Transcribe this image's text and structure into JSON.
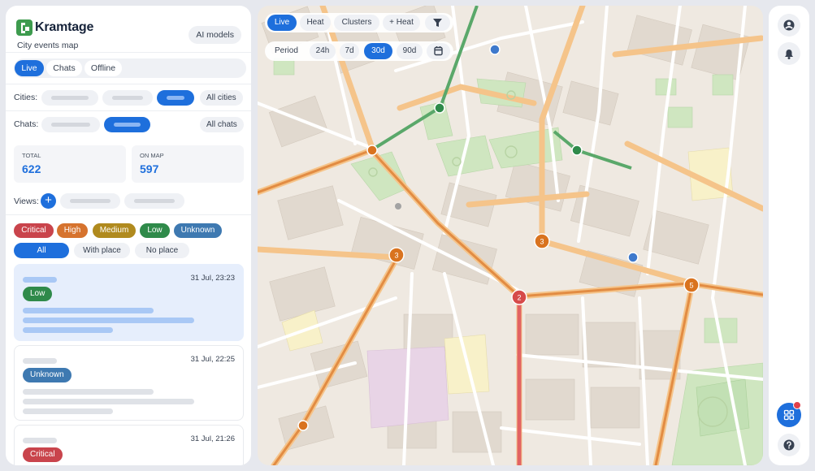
{
  "brand": {
    "name": "Kramtage",
    "subtitle": "City events map"
  },
  "header": {
    "ai_models_label": "AI models"
  },
  "modes": [
    {
      "label": "Live",
      "active": true
    },
    {
      "label": "Chats",
      "active": false
    },
    {
      "label": "Offline",
      "active": false
    }
  ],
  "filters": {
    "cities_label": "Cities:",
    "all_cities_label": "All cities",
    "chats_label": "Chats:",
    "all_chats_label": "All chats",
    "views_label": "Views:"
  },
  "stats": {
    "total_label": "TOTAL",
    "total_value": "622",
    "onmap_label": "ON MAP",
    "onmap_value": "597"
  },
  "severity": [
    {
      "label": "Critical",
      "color": "#c9444c"
    },
    {
      "label": "High",
      "color": "#d6732e"
    },
    {
      "label": "Medium",
      "color": "#b08a1e"
    },
    {
      "label": "Low",
      "color": "#2f8a4a"
    },
    {
      "label": "Unknown",
      "color": "#3e79b1"
    }
  ],
  "scope": [
    {
      "label": "All",
      "active": true
    },
    {
      "label": "With place",
      "active": false
    },
    {
      "label": "No place",
      "active": false
    }
  ],
  "events": [
    {
      "time": "31 Jul, 23:23",
      "badge": "Low",
      "badge_color": "#2f8a4a",
      "selected": true
    },
    {
      "time": "31 Jul, 22:25",
      "badge": "Unknown",
      "badge_color": "#3e79b1",
      "selected": false
    },
    {
      "time": "31 Jul, 21:26",
      "badge": "Critical",
      "badge_color": "#c9444c",
      "selected": false
    }
  ],
  "map": {
    "layers": [
      {
        "label": "Live",
        "active": true
      },
      {
        "label": "Heat",
        "active": false
      },
      {
        "label": "Clusters",
        "active": false
      },
      {
        "label": "+ Heat",
        "active": false
      }
    ],
    "period_label": "Period",
    "periods": [
      {
        "label": "24h",
        "active": false
      },
      {
        "label": "7d",
        "active": false
      },
      {
        "label": "30d",
        "active": true
      },
      {
        "label": "90d",
        "active": false
      }
    ],
    "clusters": [
      {
        "count": "3",
        "color": "#d9731f"
      },
      {
        "count": "3",
        "color": "#d9731f"
      },
      {
        "count": "5",
        "color": "#d9731f"
      },
      {
        "count": "2",
        "color": "#d64a4a"
      }
    ]
  },
  "icons": {
    "logo": "kramtage-logo",
    "filter": "filter-icon",
    "calendar": "calendar-icon",
    "profile": "profile-icon",
    "bell": "bell-icon",
    "apps": "apps-grid-icon",
    "help": "help-icon"
  },
  "colors": {
    "accent": "#1e6fdc",
    "notification": "#e0404a"
  }
}
